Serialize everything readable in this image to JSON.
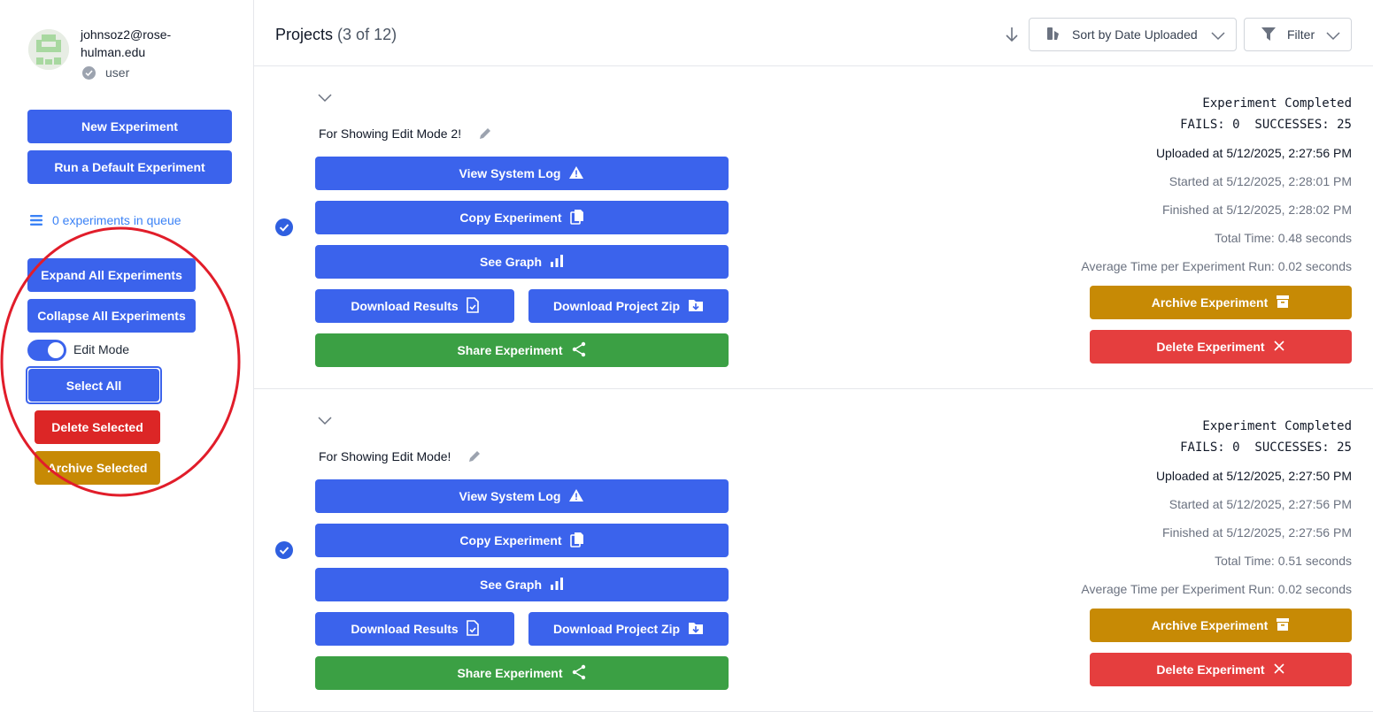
{
  "user": {
    "email": "johnsoz2@rose-hulman.edu",
    "role": "user"
  },
  "sidebar": {
    "new_experiment": "New Experiment",
    "run_default": "Run a Default Experiment",
    "queue_text": "0 experiments in queue",
    "expand_all": "Expand All Experiments",
    "collapse_all": "Collapse All Experiments",
    "edit_mode_label": "Edit Mode",
    "edit_mode_on": true,
    "select_all": "Select All",
    "delete_selected": "Delete Selected",
    "archive_selected": "Archive Selected"
  },
  "header": {
    "title": "Projects",
    "count": "(3 of 12)",
    "sort_label": "Sort by Date Uploaded",
    "filter_label": "Filter"
  },
  "projects": [
    {
      "name": "For Showing Edit Mode 2!",
      "selected": true,
      "status": "Experiment Completed",
      "counts": "FAILS: 0  SUCCESSES: 25",
      "uploaded": "Uploaded at 5/12/2025, 2:27:56 PM",
      "started": "Started at 5/12/2025, 2:28:01 PM",
      "finished": "Finished at 5/12/2025, 2:28:02 PM",
      "total_time": "Total Time: 0.48 seconds",
      "avg_time": "Average Time per Experiment Run: 0.02 seconds",
      "buttons": {
        "view_log": "View System Log",
        "copy": "Copy Experiment",
        "graph": "See Graph",
        "download_results": "Download Results",
        "download_zip": "Download Project Zip",
        "share": "Share Experiment",
        "archive": "Archive Experiment",
        "delete": "Delete Experiment"
      }
    },
    {
      "name": "For Showing Edit Mode!",
      "selected": true,
      "status": "Experiment Completed",
      "counts": "FAILS: 0  SUCCESSES: 25",
      "uploaded": "Uploaded at 5/12/2025, 2:27:50 PM",
      "started": "Started at 5/12/2025, 2:27:56 PM",
      "finished": "Finished at 5/12/2025, 2:27:56 PM",
      "total_time": "Total Time: 0.51 seconds",
      "avg_time": "Average Time per Experiment Run: 0.02 seconds",
      "buttons": {
        "view_log": "View System Log",
        "copy": "Copy Experiment",
        "graph": "See Graph",
        "download_results": "Download Results",
        "download_zip": "Download Project Zip",
        "share": "Share Experiment",
        "archive": "Archive Experiment",
        "delete": "Delete Experiment"
      }
    }
  ],
  "colors": {
    "primary": "#3b63ec",
    "share": "#3ba044",
    "archive": "#c78a05",
    "delete": "#e53e3e",
    "delete_selected": "#dc2626",
    "annotation_circle": "#e11d2a"
  }
}
